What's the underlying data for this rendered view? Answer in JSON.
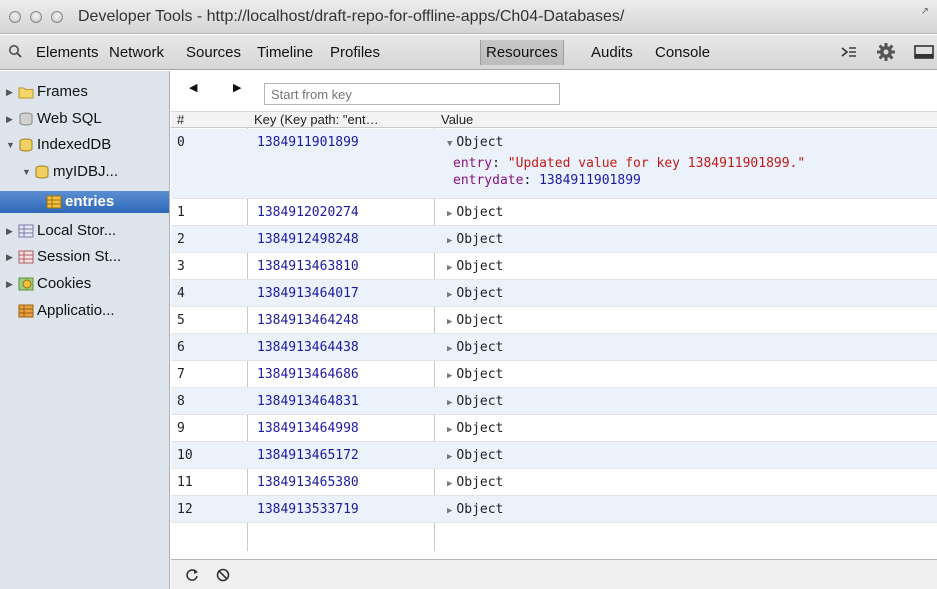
{
  "window": {
    "title": "Developer Tools - http://localhost/draft-repo-for-offline-apps/Ch04-Databases/"
  },
  "toolbar": {
    "tabs": [
      {
        "label": "Elements"
      },
      {
        "label": "Network"
      },
      {
        "label": "Sources"
      },
      {
        "label": "Timeline"
      },
      {
        "label": "Profiles"
      },
      {
        "label": "Resources",
        "active": true
      },
      {
        "label": "Audits"
      },
      {
        "label": "Console"
      }
    ],
    "icons": [
      "search-icon",
      "console-drawer-icon",
      "gear-icon",
      "dock-icon"
    ]
  },
  "sidebar": {
    "items": [
      {
        "label": "Frames",
        "icon": "folder-icon",
        "expanded": false
      },
      {
        "label": "Web SQL",
        "icon": "database-icon",
        "expanded": false
      },
      {
        "label": "IndexedDB",
        "icon": "database-icon",
        "expanded": true
      },
      {
        "label": "myIDBJ...",
        "icon": "database-icon",
        "expanded": true
      },
      {
        "label": "entries",
        "icon": "table-icon",
        "selected": true
      },
      {
        "label": "Local Stor...",
        "icon": "grid-icon",
        "expanded": false
      },
      {
        "label": "Session St...",
        "icon": "grid-icon",
        "expanded": false
      },
      {
        "label": "Cookies",
        "icon": "cookie-icon",
        "expanded": false
      },
      {
        "label": "Applicatio...",
        "icon": "table-icon"
      }
    ]
  },
  "main": {
    "start_key_placeholder": "Start from key",
    "columns": {
      "index": "#",
      "key": "Key (Key path: \"ent…",
      "value": "Value"
    },
    "rows": [
      {
        "index": "0",
        "key": "1384911901899",
        "value": "Object",
        "expanded": true
      },
      {
        "index": "1",
        "key": "1384912020274",
        "value": "Object"
      },
      {
        "index": "2",
        "key": "1384912498248",
        "value": "Object"
      },
      {
        "index": "3",
        "key": "1384913463810",
        "value": "Object"
      },
      {
        "index": "4",
        "key": "1384913464017",
        "value": "Object"
      },
      {
        "index": "5",
        "key": "1384913464248",
        "value": "Object"
      },
      {
        "index": "6",
        "key": "1384913464438",
        "value": "Object"
      },
      {
        "index": "7",
        "key": "1384913464686",
        "value": "Object"
      },
      {
        "index": "8",
        "key": "1384913464831",
        "value": "Object"
      },
      {
        "index": "9",
        "key": "1384913464998",
        "value": "Object"
      },
      {
        "index": "10",
        "key": "1384913465172",
        "value": "Object"
      },
      {
        "index": "11",
        "key": "1384913465380",
        "value": "Object"
      },
      {
        "index": "12",
        "key": "1384913533719",
        "value": "Object"
      }
    ],
    "expanded_object": {
      "entry_name": "entry",
      "entry_value": "\"Updated value for key 1384911901899.\"",
      "entrydate_name": "entrydate",
      "entrydate_value": "1384911901899"
    }
  },
  "statusbar": {
    "icons": [
      "refresh-icon",
      "clear-icon"
    ]
  },
  "colors": {
    "selection": "#2d68b8",
    "alt_row": "#ebf2fb",
    "key_blue": "#1a1aa6",
    "string_red": "#c41a16",
    "prop_purple": "#881280"
  }
}
